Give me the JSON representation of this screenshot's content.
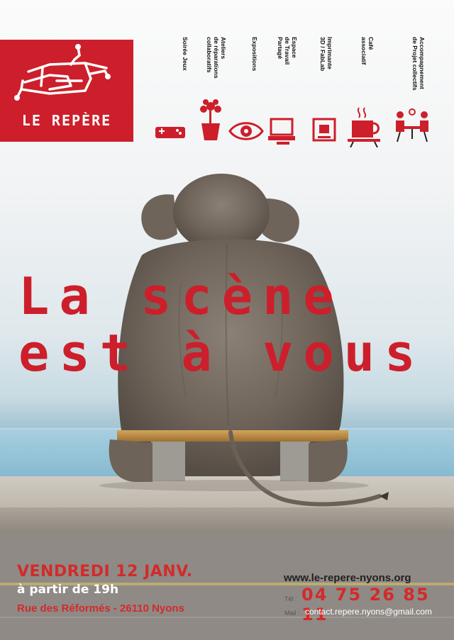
{
  "brand": {
    "name": "LE REPÈRE",
    "accent": "#cc1f2b"
  },
  "services": [
    {
      "label": "Soirée Jeux",
      "icon": "video-game-icon"
    },
    {
      "label": "Ateliers\nde réparations\ncollaboratifs",
      "icon": "flower-pot-icon"
    },
    {
      "label": "Expositions",
      "icon": "eye-icon"
    },
    {
      "label": "Espace\nde Travail\nPartagé",
      "icon": "computer-icon"
    },
    {
      "label": "Imprimante\n3D / FabLab",
      "icon": "3d-printer-icon"
    },
    {
      "label": "Café\nassociatif",
      "icon": "coffee-cup-icon"
    },
    {
      "label": "Accompagnement\nde Projet collectifs",
      "icon": "meeting-icon"
    }
  ],
  "headline": {
    "line1": "La scène",
    "line2": "est à vous"
  },
  "event": {
    "date": "VENDREDI 12 JANV.",
    "time": "à partir de 19h",
    "address": "Rue des Réformés - 26110 Nyons"
  },
  "contact": {
    "website": "www.le-repere-nyons.org",
    "phone_prefix": "Tél :",
    "phone": "04 75 26 85 11",
    "mail_prefix": "Mail :",
    "email": "contact.repere.nyons@gmail.com"
  }
}
